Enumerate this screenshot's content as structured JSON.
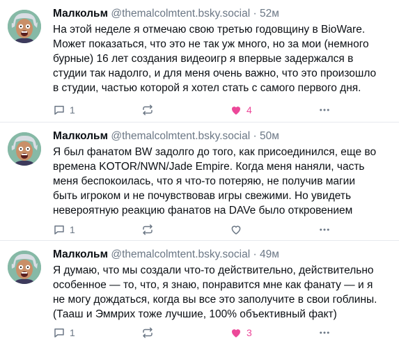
{
  "colors": {
    "like": "#ec4899",
    "muted": "#6b7785",
    "text": "#0b0f14",
    "divider": "#e6e9ee"
  },
  "posts": [
    {
      "name": "Малкольм",
      "handle": "@themalcolmtent.bsky.social",
      "dot": "·",
      "time": "52м",
      "lines": [
        "На этой неделе я отмечаю свою третью годовщину в BioWare.",
        "Может показаться, что это не так уж много, но за мои (немного",
        "бурные) 16 лет создания видеоигр я впервые задержался в",
        "студии так надолго, и для меня очень важно, что это произошло",
        "в студии, частью которой я хотел стать с самого первого дня."
      ],
      "replies": "1",
      "reposts": "",
      "likes": "4"
    },
    {
      "name": "Малкольм",
      "handle": "@themalcolmtent.bsky.social",
      "dot": "·",
      "time": "50м",
      "lines": [
        "Я был фанатом BW задолго до того, как присоединился, еще во",
        "времена KOTOR/NWN/Jade Empire. Когда меня наняли, часть",
        "меня беспокоилась, что я что-то потеряю, не получив магии",
        "быть игроком и не почувствовав игры свежими. Но увидеть",
        "невероятную реакцию фанатов на DAVe было откровением"
      ],
      "replies": "1",
      "reposts": "",
      "likes": ""
    },
    {
      "name": "Малкольм",
      "handle": "@themalcolmtent.bsky.social",
      "dot": "·",
      "time": "49м",
      "lines": [
        "Я думаю, что мы создали что-то действительно, действительно",
        "особенное — то, что, я знаю, понравится мне как фанату — и я",
        "не могу дождаться, когда вы все это заполучите в свои гоблины.",
        "(Тааш и Эммрих тоже лучшие, 100% объективный факт)"
      ],
      "replies": "1",
      "reposts": "",
      "likes": "3"
    }
  ]
}
